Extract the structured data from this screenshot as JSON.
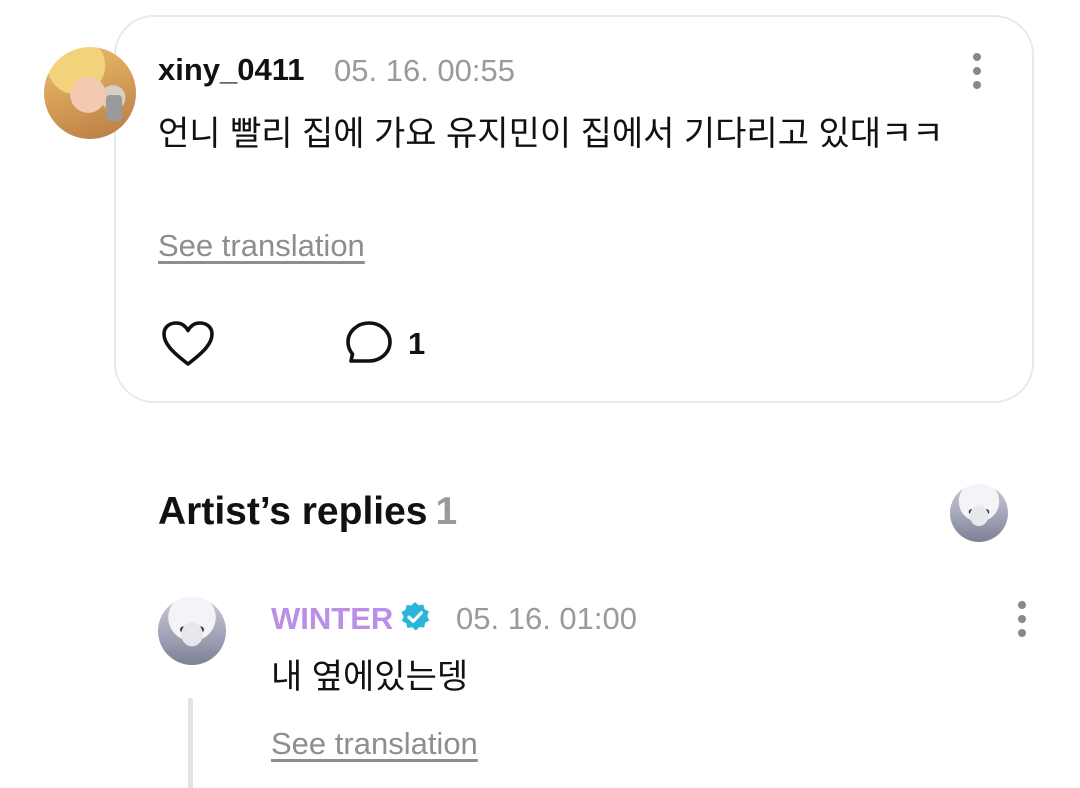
{
  "comment": {
    "username": "xiny_0411",
    "timestamp": "05. 16. 00:55",
    "text": "언니 빨리 집에 가요 유지민이 집에서 기다리고 있대ㅋㅋ",
    "see_translation": "See translation",
    "reply_count": "1",
    "icons": {
      "like": "heart-icon",
      "reply": "comment-bubble-icon",
      "more": "more-vertical-icon"
    }
  },
  "artist_replies": {
    "title": "Artist’s replies",
    "count": "1",
    "replies": [
      {
        "name": "WINTER",
        "verified": true,
        "timestamp": "05. 16. 01:00",
        "text": "내 옆에있는뎅",
        "see_translation": "See translation"
      }
    ]
  },
  "colors": {
    "artist_name": "#b98fe8",
    "verified_badge": "#2bb6d9",
    "muted_text": "#9a9a9a",
    "card_border": "#e9e9ec"
  }
}
